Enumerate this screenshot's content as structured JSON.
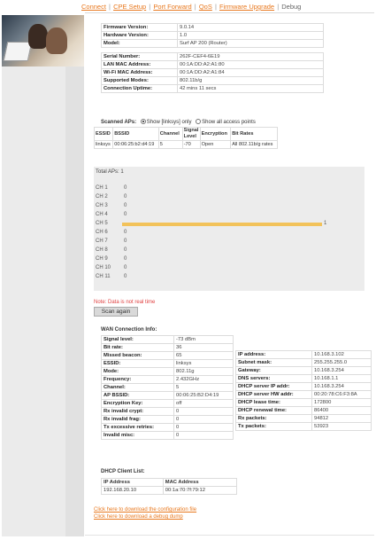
{
  "nav": {
    "links": [
      "Connect",
      "CPE Setup",
      "Port Forward",
      "QoS",
      "Firmware Upgrade"
    ],
    "current": "Debug",
    "separator": "|",
    "link_color": "#e8781e"
  },
  "info": [
    {
      "k": "Firmware Version:",
      "v": "9.0.14"
    },
    {
      "k": "Hardware Version:",
      "v": "1.0"
    },
    {
      "k": "Model:",
      "v": "Surf AP 200 (Router)"
    },
    {
      "k": "Serial Number:",
      "v": "262F-CEF4-6E19"
    },
    {
      "k": "LAN MAC Address:",
      "v": "00:1A:DD:A2:A1:80"
    },
    {
      "k": "Wi-Fi MAC Address:",
      "v": "00:1A:DD:A2:A1:84"
    },
    {
      "k": "Supported Modes:",
      "v": "802.11b/g"
    },
    {
      "k": "Connection Uptime:",
      "v": "42 mins 11 secs"
    }
  ],
  "scanned": {
    "label": "Scanned APs:",
    "opt1": "Show [linksys] only",
    "opt2": "Show all access points",
    "headers": [
      "ESSID",
      "BSSID",
      "Channel",
      "Signal Level",
      "Encryption",
      "Bit Rates"
    ],
    "rows": [
      [
        "linksys",
        "00:06:25:b2:d4:19",
        "5",
        "-70",
        "Open",
        "All 802.11b/g rates"
      ]
    ]
  },
  "channels": {
    "total_label": "Total APs:",
    "total": "1",
    "rows": [
      {
        "label": "CH 1",
        "count": "0",
        "frac": 0
      },
      {
        "label": "CH 2",
        "count": "0",
        "frac": 0
      },
      {
        "label": "CH 3",
        "count": "0",
        "frac": 0
      },
      {
        "label": "CH 4",
        "count": "0",
        "frac": 0
      },
      {
        "label": "CH 5",
        "count": "1",
        "frac": 1
      },
      {
        "label": "CH 6",
        "count": "0",
        "frac": 0
      },
      {
        "label": "CH 7",
        "count": "0",
        "frac": 0
      },
      {
        "label": "CH 8",
        "count": "0",
        "frac": 0
      },
      {
        "label": "CH 9",
        "count": "0",
        "frac": 0
      },
      {
        "label": "CH 10",
        "count": "0",
        "frac": 0
      },
      {
        "label": "CH 11",
        "count": "0",
        "frac": 0
      }
    ],
    "bar_color": "#f2c25a"
  },
  "note": "Note: Data is not real time",
  "scan_button": "Scan again",
  "wan": {
    "title": "WAN Connection Info:",
    "left": [
      {
        "k": "Signal level:",
        "v": "-73 dBm"
      },
      {
        "k": "Bit rate:",
        "v": "36"
      },
      {
        "k": "Missed beacon:",
        "v": "65"
      },
      {
        "k": "ESSID:",
        "v": "linksys"
      },
      {
        "k": "Mode:",
        "v": "802.11g"
      },
      {
        "k": "Frequency:",
        "v": "2.432GHz"
      },
      {
        "k": "Channel:",
        "v": "5"
      },
      {
        "k": "AP BSSID:",
        "v": "00:06:25:B2:D4:19"
      },
      {
        "k": "Encryption Key:",
        "v": "off"
      },
      {
        "k": "Rx invalid crypt:",
        "v": "0"
      },
      {
        "k": "Rx invalid frag:",
        "v": "0"
      },
      {
        "k": "Tx excessive retries:",
        "v": "0"
      },
      {
        "k": "Invalid misc:",
        "v": "0"
      }
    ],
    "right": [
      {
        "k": "IP address:",
        "v": "10.168.3.102"
      },
      {
        "k": "Subnet mask:",
        "v": "255.255.255.0"
      },
      {
        "k": "Gateway:",
        "v": "10.168.3.254"
      },
      {
        "k": "DNS servers:",
        "v": "10.168.1.1"
      },
      {
        "k": "DHCP server IP addr:",
        "v": "10.168.3.254"
      },
      {
        "k": "DHCP server HW addr:",
        "v": "00:20:78:C6:F3:8A"
      },
      {
        "k": "DHCP lease time:",
        "v": "172800"
      },
      {
        "k": "DHCP renewal time:",
        "v": "86400"
      },
      {
        "k": "Rx packets:",
        "v": "94812"
      },
      {
        "k": "Tx packets:",
        "v": "53923"
      }
    ]
  },
  "dhcp": {
    "title": "DHCP Client List:",
    "headers": [
      "IP Address",
      "MAC Address"
    ],
    "rows": [
      [
        "192.168.20.10",
        "00:1a:70:7f:79:12"
      ]
    ]
  },
  "links": {
    "config": "Click here to download the configuration file",
    "dump": "Click here to download a debug dump"
  }
}
